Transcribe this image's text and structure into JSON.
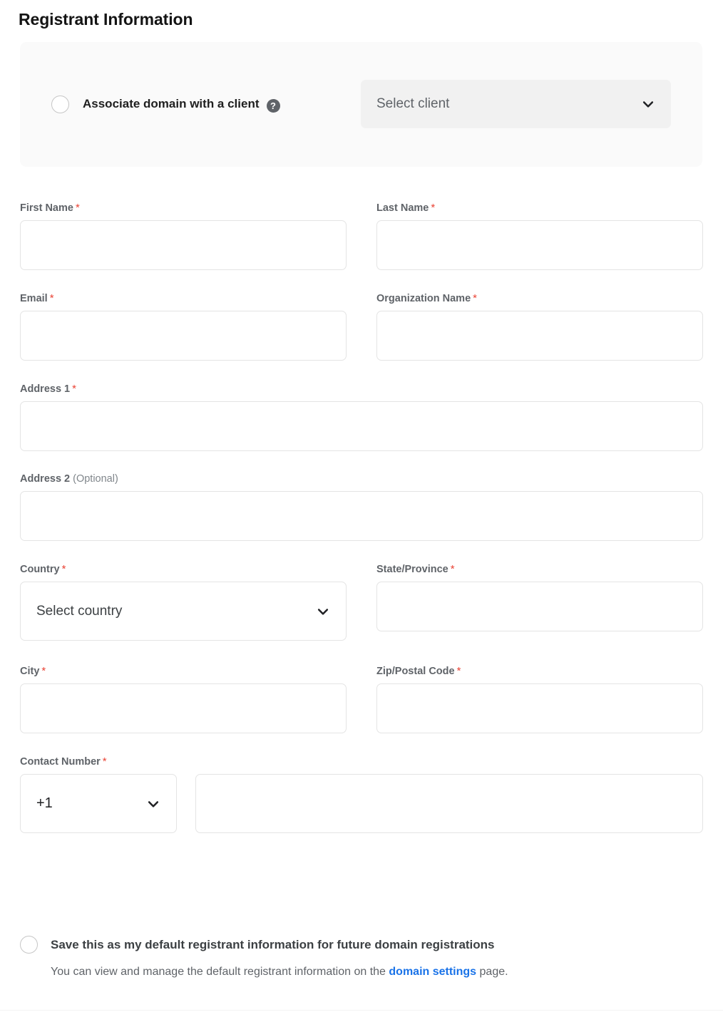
{
  "page_title": "Registrant Information",
  "client_card": {
    "radio_name": "associate-domain-radio",
    "label": "Associate domain with a client",
    "help_icon_glyph": "?",
    "help_icon_name": "help-circle-icon",
    "select": {
      "placeholder": "Select client",
      "value": "",
      "disabled": true,
      "chevron_icon": "chevron-down-icon"
    },
    "background_color": "#fafafa",
    "select_background_color": "#f1f1f1"
  },
  "fields": {
    "first_name": {
      "label": "First Name",
      "required_mark": "*",
      "value": "",
      "placeholder": ""
    },
    "last_name": {
      "label": "Last Name",
      "required_mark": "*",
      "value": "",
      "placeholder": ""
    },
    "email": {
      "label": "Email",
      "required_mark": "*",
      "value": "",
      "placeholder": ""
    },
    "organization_name": {
      "label": "Organization Name",
      "required_mark": "*",
      "value": "",
      "placeholder": ""
    },
    "address_1": {
      "label": "Address 1",
      "required_mark": "*",
      "value": "",
      "placeholder": ""
    },
    "address_2": {
      "label": "Address 2",
      "optional_mark": "(Optional)",
      "value": "",
      "placeholder": ""
    },
    "country": {
      "label": "Country",
      "required_mark": "*",
      "placeholder": "Select country",
      "value": "",
      "chevron_icon": "chevron-down-icon"
    },
    "state_province": {
      "label": "State/Province",
      "required_mark": "*",
      "value": "",
      "placeholder": ""
    },
    "city": {
      "label": "City",
      "required_mark": "*",
      "value": "",
      "placeholder": ""
    },
    "zip_postal_code": {
      "label": "Zip/Postal Code",
      "required_mark": "*",
      "value": "",
      "placeholder": ""
    },
    "contact_number": {
      "label": "Contact Number",
      "required_mark": "*",
      "country_code": "+1",
      "chevron_icon": "chevron-down-icon",
      "number_value": "",
      "number_placeholder": ""
    }
  },
  "save_default": {
    "radio_name": "save-default-radio",
    "label": "Save this as my default registrant information for future domain registrations",
    "help_text_before": "You can view and manage the default registrant information on the ",
    "link_text": "domain settings",
    "help_text_after": " page."
  },
  "colors": {
    "required_asterisk": "#ea4335",
    "link": "#1a73e8",
    "label": "#5f6368",
    "border": "#e4e4e4",
    "title": "#141414"
  }
}
